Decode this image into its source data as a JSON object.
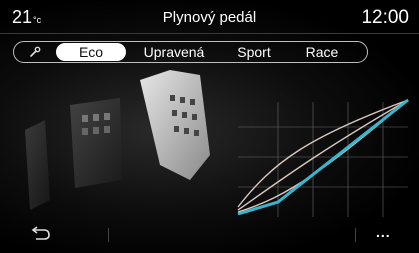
{
  "header": {
    "temperature": "21",
    "temperature_unit": "°c",
    "title": "Plynový pedál",
    "clock": "12:00"
  },
  "selector": {
    "icon": "wrench-icon",
    "tabs": [
      {
        "label": "Eco",
        "selected": true
      },
      {
        "label": "Upravená",
        "selected": false
      },
      {
        "label": "Sport",
        "selected": false
      },
      {
        "label": "Race",
        "selected": false
      }
    ]
  },
  "graph": {
    "accent_color": "#38b6cf",
    "line_color": "#d9c8c0"
  },
  "footer": {
    "back_icon": "back-arrow-icon",
    "more_label": "..."
  }
}
